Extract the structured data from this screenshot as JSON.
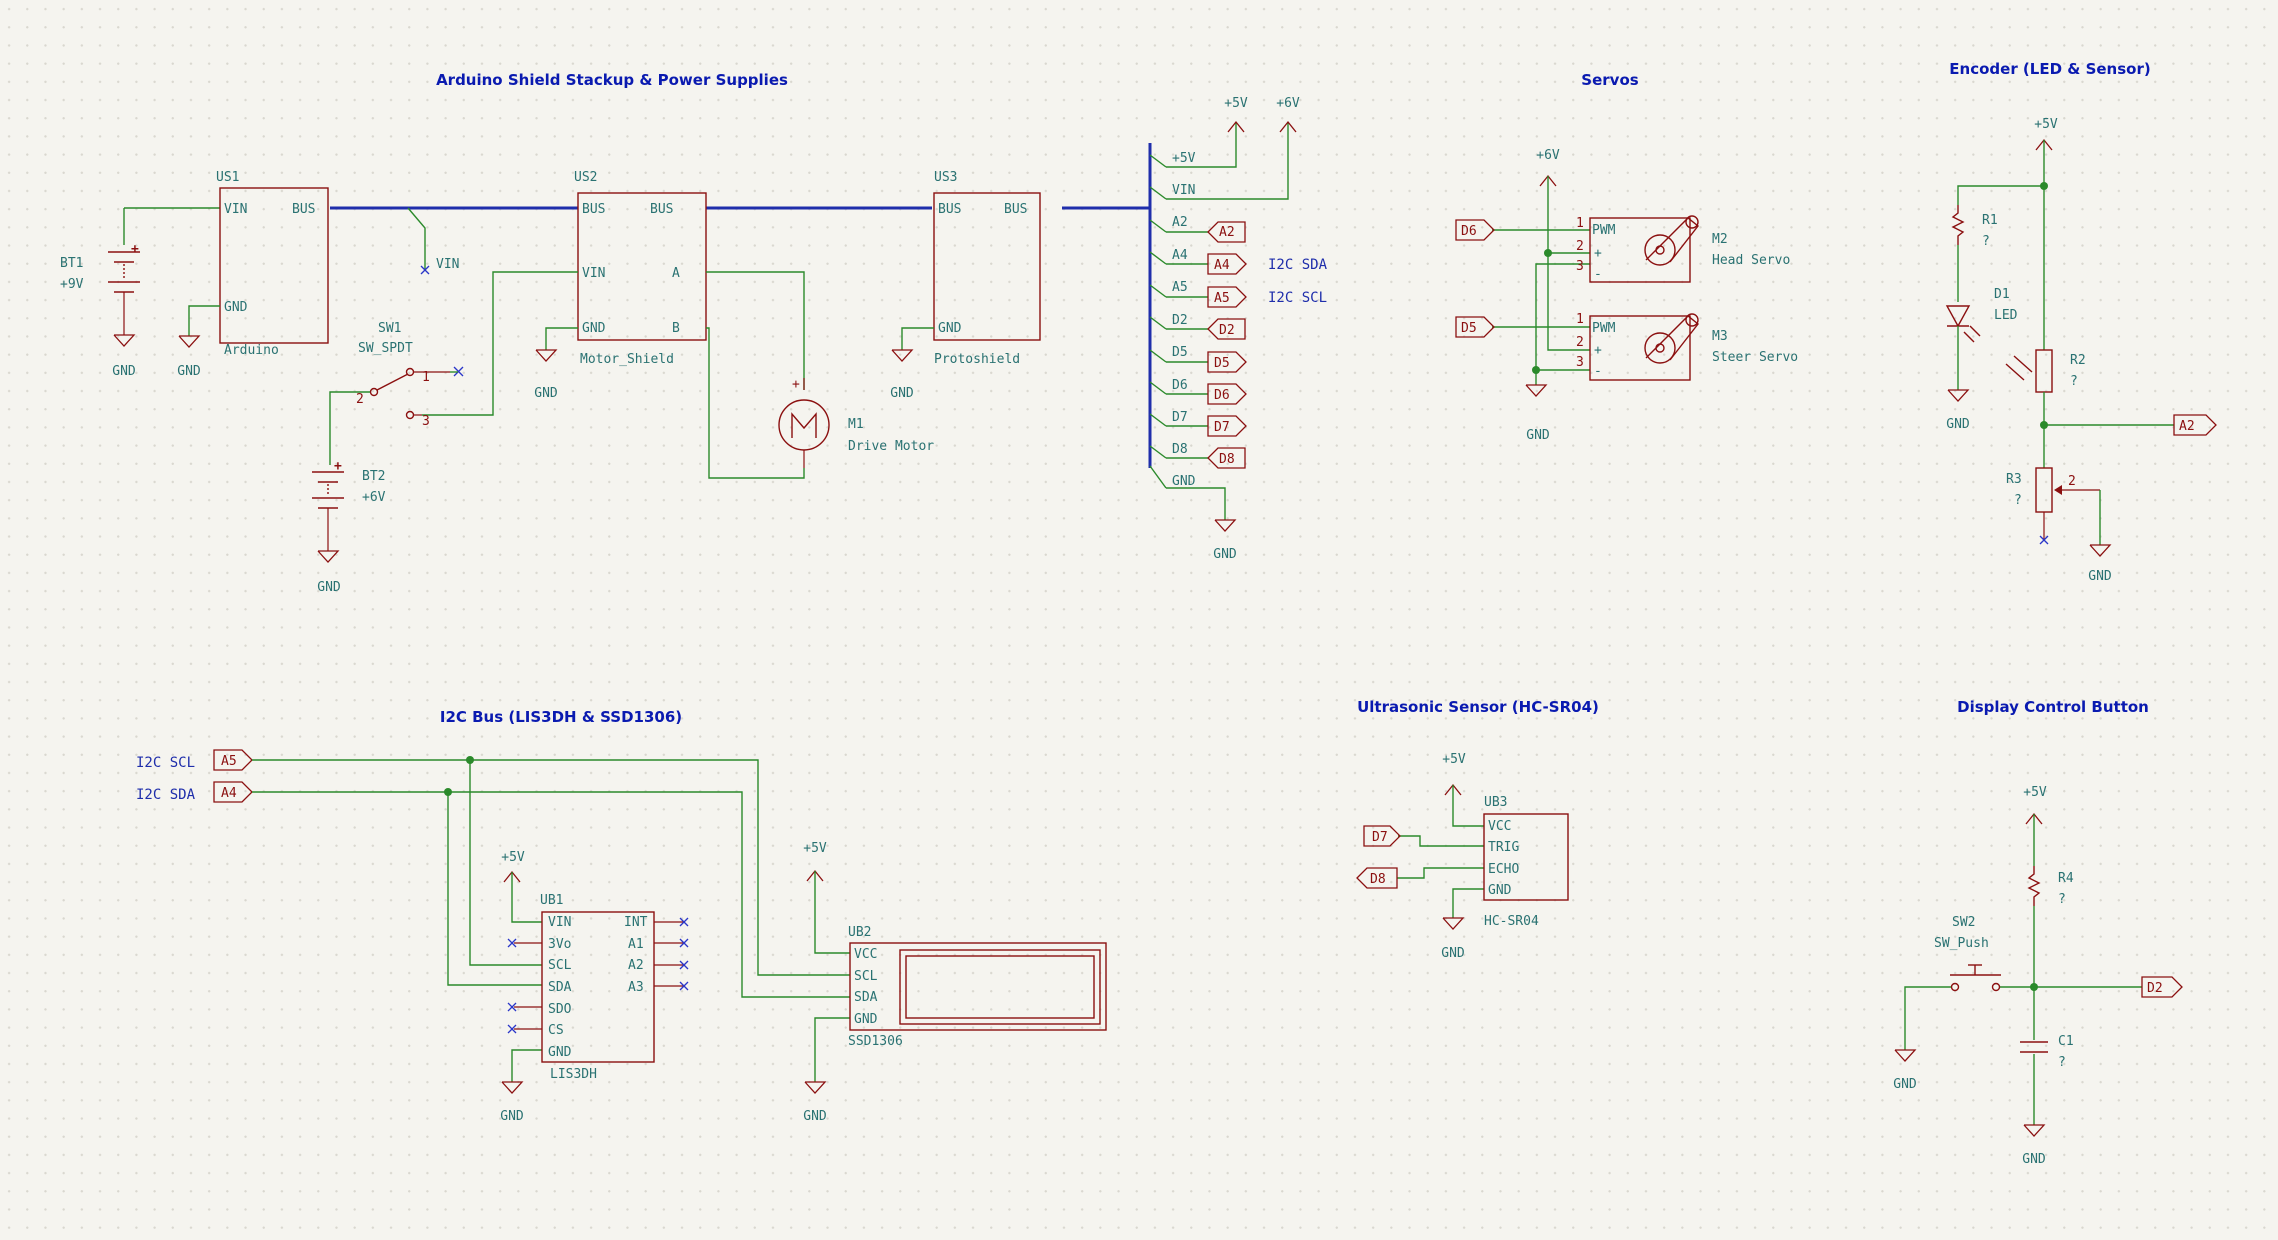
{
  "sections": {
    "shield_stack": "Arduino Shield Stackup & Power Supplies",
    "servos": "Servos",
    "encoder": "Encoder (LED & Sensor)",
    "i2c_bus": "I2C Bus (LIS3DH & SSD1306)",
    "ultrasonic": "Ultrasonic Sensor (HC-SR04)",
    "display_button": "Display Control Button"
  },
  "power": {
    "gnd": "GND",
    "p5v": "+5V",
    "p6v": "+6V",
    "p9v": "+9V"
  },
  "components": {
    "us1": {
      "ref": "US1",
      "value": "Arduino",
      "pins": [
        "VIN",
        "BUS",
        "GND"
      ]
    },
    "us2": {
      "ref": "US2",
      "value": "Motor_Shield",
      "pins": [
        "BUS",
        "BUS",
        "VIN",
        "A",
        "GND",
        "B"
      ]
    },
    "us3": {
      "ref": "US3",
      "value": "Protoshield",
      "pins": [
        "BUS",
        "BUS",
        "GND"
      ]
    },
    "bt1": {
      "ref": "BT1",
      "value": "+9V"
    },
    "bt2": {
      "ref": "BT2",
      "value": "+6V"
    },
    "sw1": {
      "ref": "SW1",
      "value": "SW_SPDT",
      "pins": [
        "1",
        "2",
        "3"
      ]
    },
    "m1": {
      "ref": "M1",
      "value": "Drive Motor"
    },
    "m2": {
      "ref": "M2",
      "value": "Head Servo"
    },
    "m3": {
      "ref": "M3",
      "value": "Steer Servo"
    },
    "servo_pins": {
      "pwm": "PWM",
      "plus": "+",
      "minus": "-",
      "n1": "1",
      "n2": "2",
      "n3": "3"
    },
    "r1": {
      "ref": "R1",
      "value": "?"
    },
    "d1": {
      "ref": "D1",
      "value": "LED"
    },
    "r2": {
      "ref": "R2",
      "value": "?"
    },
    "r3": {
      "ref": "R3",
      "value": "?",
      "pin": "2"
    },
    "ub1": {
      "ref": "UB1",
      "value": "LIS3DH",
      "left_pins": [
        "VIN",
        "3Vo",
        "SCL",
        "SDA",
        "SDO",
        "CS",
        "GND"
      ],
      "right_pins": [
        "INT",
        "A1",
        "A2",
        "A3"
      ]
    },
    "ub2": {
      "ref": "UB2",
      "value": "SSD1306",
      "pins": [
        "VCC",
        "SCL",
        "SDA",
        "GND"
      ]
    },
    "ub3": {
      "ref": "UB3",
      "value": "HC-SR04",
      "pins": [
        "VCC",
        "TRIG",
        "ECHO",
        "GND"
      ]
    },
    "r4": {
      "ref": "R4",
      "value": "?"
    },
    "c1": {
      "ref": "C1",
      "value": "?"
    },
    "sw2": {
      "ref": "SW2",
      "value": "SW_Push"
    }
  },
  "bus_entries": [
    "+5V",
    "VIN",
    "A2",
    "A4",
    "A5",
    "D2",
    "D5",
    "D6",
    "D7",
    "D8",
    "GND"
  ],
  "net_labels": {
    "vin": "VIN",
    "i2c_sda": "I2C SDA",
    "i2c_scl": "I2C SCL"
  },
  "global_labels": {
    "a2": "A2",
    "a4": "A4",
    "a5": "A5",
    "d2": "D2",
    "d5": "D5",
    "d6": "D6",
    "d7": "D7",
    "d8": "D8"
  }
}
